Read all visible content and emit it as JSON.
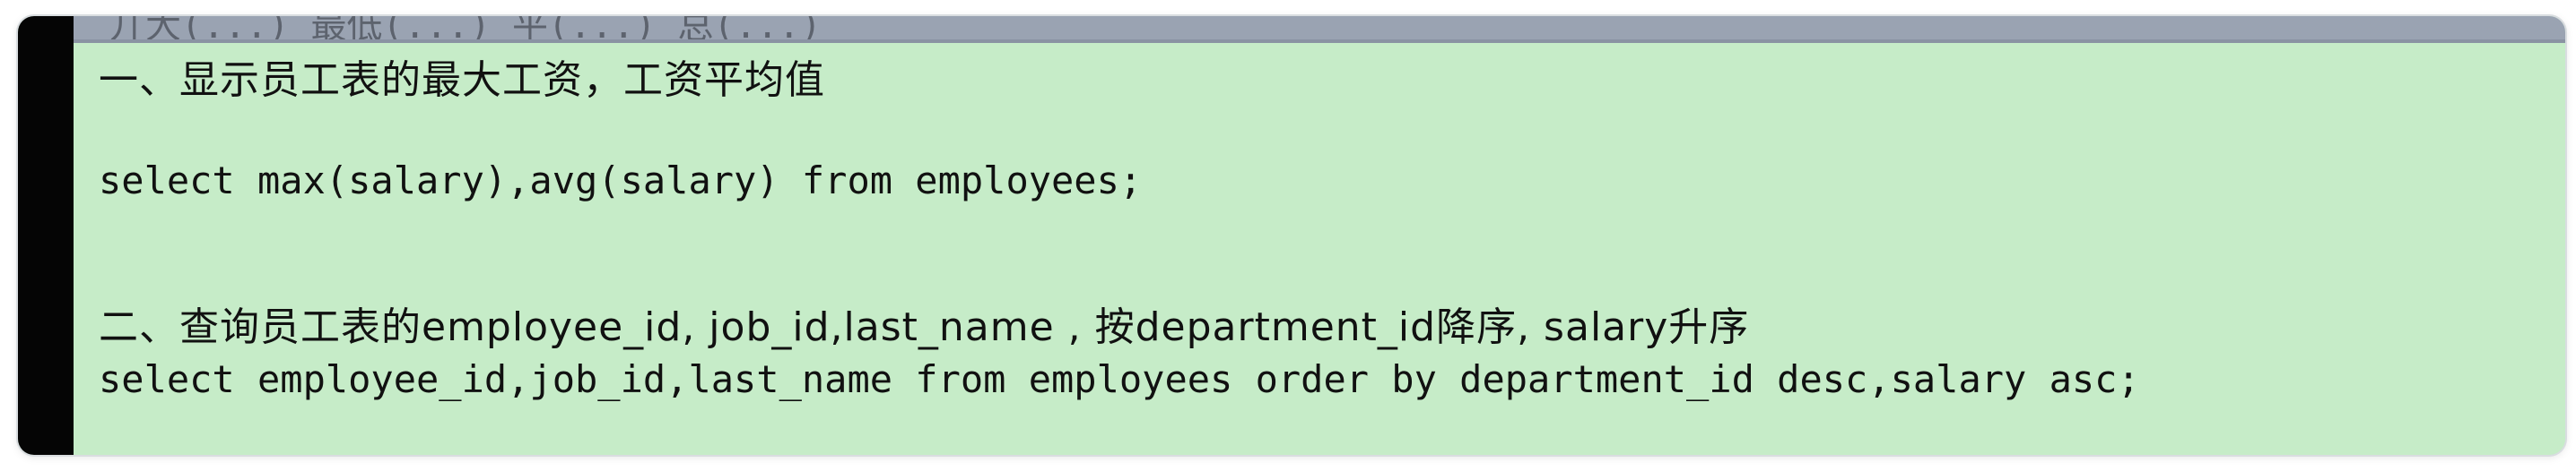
{
  "topbar": {
    "partial_text": "丌大(...) 最低(...) 平(...) 总(...)"
  },
  "editor": {
    "lines": [
      "一、显示员工表的最大工资，工资平均值",
      "select max(salary),avg(salary) from employees;",
      "二、查询员工表的employee_id, job_id,last_name , 按department_id降序, salary升序",
      "select employee_id,job_id,last_name from employees order by department_id desc,salary asc;"
    ]
  }
}
